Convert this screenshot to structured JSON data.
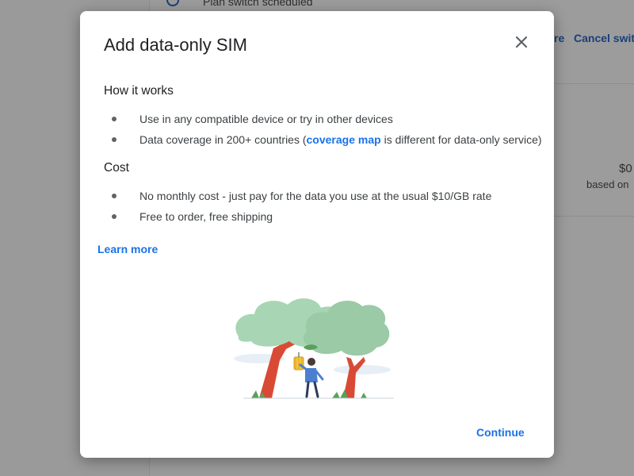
{
  "background": {
    "status_label": "Plan switch scheduled",
    "action_fragment": "re",
    "cancel_label": "Cancel switc",
    "price_fragment": "$0",
    "note_fragment": "based on"
  },
  "dialog": {
    "title": "Add data-only SIM",
    "sections": [
      {
        "heading": "How it works",
        "items": [
          {
            "text": "Use in any compatible device or try in other devices"
          },
          {
            "prefix": "Data coverage in 200+ countries (",
            "link": "coverage map",
            "suffix": " is different for data-only service)"
          }
        ]
      },
      {
        "heading": "Cost",
        "items": [
          {
            "text": "No monthly cost - just pay for the data you use at the usual $10/GB rate"
          },
          {
            "text": "Free to order, free shipping"
          }
        ]
      }
    ],
    "learn_more": "Learn more",
    "continue_label": "Continue"
  },
  "icons": {
    "close": "close-icon",
    "sync": "sync-icon",
    "illustration": "person-with-trees-illustration"
  },
  "colors": {
    "accent": "#1a73e8",
    "tree_trunk": "#d94a35",
    "foliage": "#a8d5b3",
    "text": "#202124"
  }
}
